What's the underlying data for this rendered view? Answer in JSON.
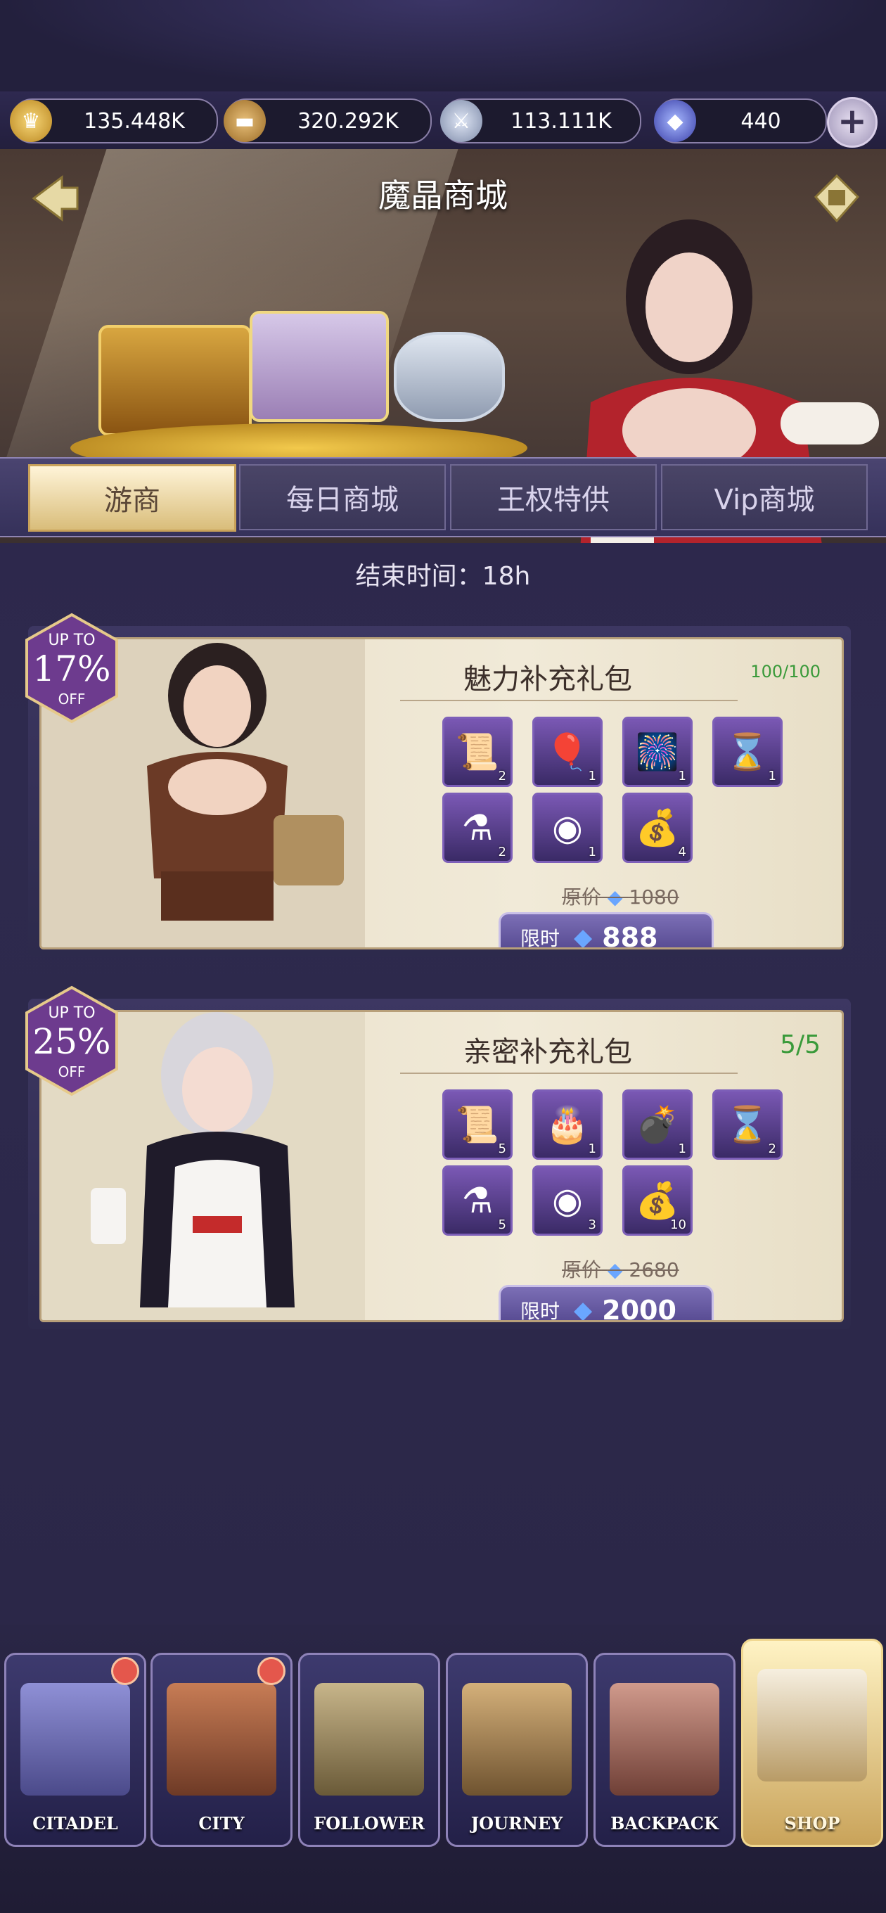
{
  "resources": [
    {
      "icon": "gold-coin-icon",
      "value": "135.448K"
    },
    {
      "icon": "bread-icon",
      "value": "320.292K"
    },
    {
      "icon": "crystal-orb-icon",
      "value": "113.111K"
    },
    {
      "icon": "gem-icon",
      "value": "440"
    }
  ],
  "plus_label": "+",
  "hero": {
    "title": "魔晶商城"
  },
  "tabs": [
    {
      "label": "游商",
      "active": true
    },
    {
      "label": "每日商城",
      "active": false
    },
    {
      "label": "王权特供",
      "active": false
    },
    {
      "label": "Vip商城",
      "active": false
    }
  ],
  "end_time": "结束时间：18h",
  "packs": [
    {
      "discount_up": "UP TO",
      "discount_pct": "17%",
      "discount_off": "OFF",
      "title": "魅力补充礼包",
      "count": "100/100",
      "items": [
        {
          "icon": "scroll-icon",
          "qty": "2"
        },
        {
          "icon": "balloons-icon",
          "qty": "1"
        },
        {
          "icon": "firework-icon",
          "qty": "1"
        },
        {
          "icon": "hourglass-icon",
          "qty": "1"
        },
        {
          "icon": "potion-icon",
          "qty": "2"
        },
        {
          "icon": "coin-orb-icon",
          "qty": "1"
        },
        {
          "icon": "gold-sack-icon",
          "qty": "4"
        }
      ],
      "orig_label": "原价",
      "orig_price": "1080",
      "buy_tag": "限时",
      "buy_price": "888"
    },
    {
      "discount_up": "UP TO",
      "discount_pct": "25%",
      "discount_off": "OFF",
      "title": "亲密补充礼包",
      "count": "5/5",
      "items": [
        {
          "icon": "scroll-icon",
          "qty": "5"
        },
        {
          "icon": "cake-icon",
          "qty": "1"
        },
        {
          "icon": "cannon-icon",
          "qty": "1"
        },
        {
          "icon": "hourglass-icon",
          "qty": "2"
        },
        {
          "icon": "potion-icon",
          "qty": "5"
        },
        {
          "icon": "coin-orb-icon",
          "qty": "3"
        },
        {
          "icon": "gold-sack-icon",
          "qty": "10"
        }
      ],
      "orig_label": "原价",
      "orig_price": "2680",
      "buy_tag": "限时",
      "buy_price": "2000"
    }
  ],
  "nav": [
    {
      "label": "CITADEL",
      "icon": "castle-icon",
      "badge": true,
      "active": false
    },
    {
      "label": "CITY",
      "icon": "gate-icon",
      "badge": true,
      "active": false
    },
    {
      "label": "FOLLOWER",
      "icon": "helmet-icon",
      "badge": false,
      "active": false
    },
    {
      "label": "JOURNEY",
      "icon": "crossed-swords-icon",
      "badge": false,
      "active": false
    },
    {
      "label": "BACKPACK",
      "icon": "backpack-icon",
      "badge": false,
      "active": false
    },
    {
      "label": "SHOP",
      "icon": "shop-icon",
      "badge": false,
      "active": true
    }
  ]
}
